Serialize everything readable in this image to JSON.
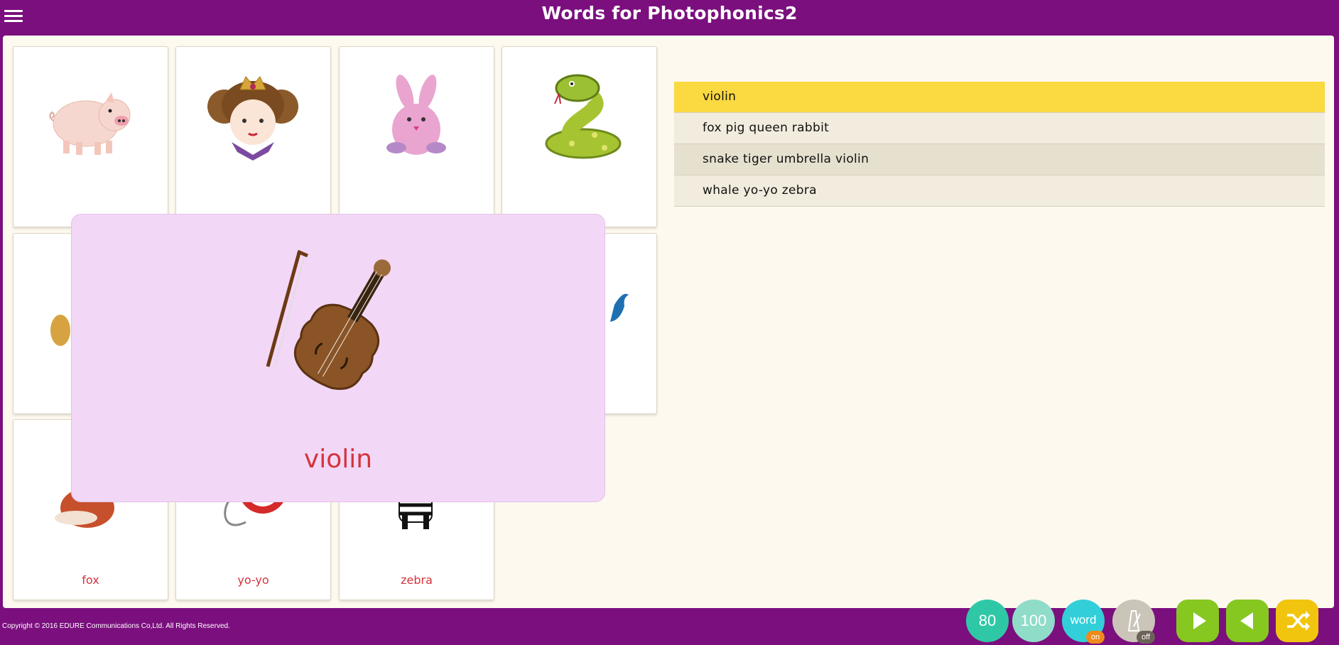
{
  "header": {
    "title": "Words for Photophonics2",
    "menu_icon": "hamburger-icon"
  },
  "cards": [
    {
      "word": "",
      "icon": "pig-icon"
    },
    {
      "word": "",
      "icon": "queen-icon"
    },
    {
      "word": "",
      "icon": "rabbit-icon"
    },
    {
      "word": "",
      "icon": "snake-icon"
    },
    {
      "word": "fox",
      "icon": "fox-icon"
    },
    {
      "word": "yo-yo",
      "icon": "yoyo-icon"
    },
    {
      "word": "zebra",
      "icon": "zebra-icon"
    }
  ],
  "popup": {
    "word": "violin",
    "icon": "violin-icon"
  },
  "word_list": [
    {
      "text": "violin",
      "state": "active"
    },
    {
      "text": "fox pig queen rabbit",
      "state": ""
    },
    {
      "text": "snake tiger umbrella violin",
      "state": ""
    },
    {
      "text": "whale yo-yo zebra",
      "state": ""
    }
  ],
  "footer": {
    "copyright": "Copyright © 2016 EDURE Communications Co,Ltd. All Rights Reserved.",
    "speed_80": "80",
    "speed_100": "100",
    "word_toggle": {
      "label": "word",
      "state": "on"
    },
    "metronome_toggle": {
      "state": "off"
    }
  },
  "colors": {
    "brand_purple": "#7b0f7e",
    "card_word_red": "#d5333c",
    "active_row_yellow": "#fbd940",
    "popup_pink": "#f3d7f6",
    "play_green": "#86c720",
    "shuffle_yellow": "#f1c50e"
  }
}
